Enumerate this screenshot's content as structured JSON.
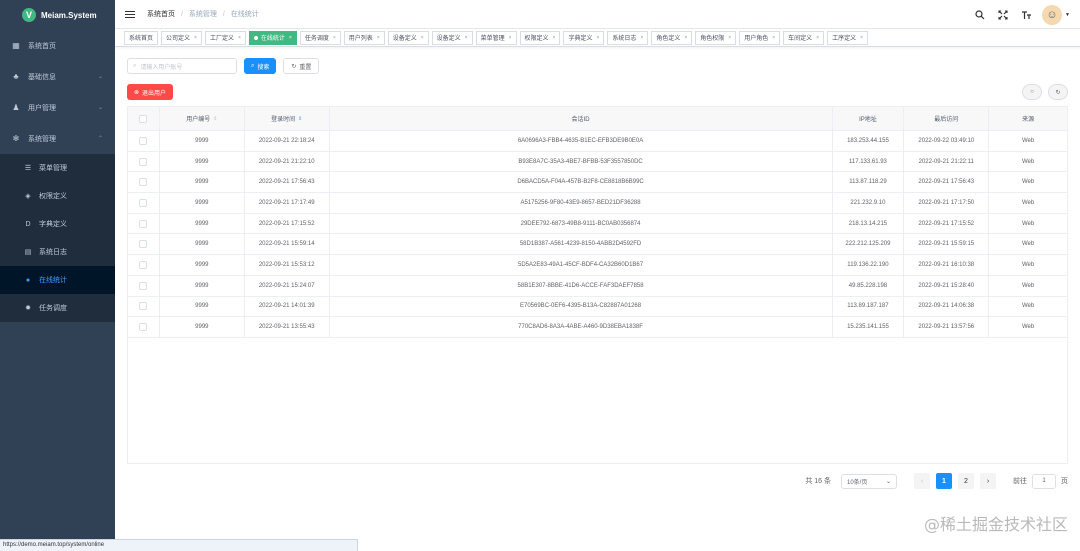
{
  "app": {
    "logo_letter": "V",
    "logo_text": "Meiam.System"
  },
  "sidebar": {
    "items": [
      {
        "label": "系统首页",
        "icon": "dashboard-icon"
      },
      {
        "label": "基础信息",
        "icon": "tree-icon",
        "chevron": "⌄"
      },
      {
        "label": "用户管理",
        "icon": "user-icon",
        "chevron": "⌄"
      },
      {
        "label": "系统管理",
        "icon": "gear-icon",
        "chevron": "⌃"
      }
    ],
    "subitems": [
      {
        "label": "菜单管理",
        "icon": "list-icon"
      },
      {
        "label": "权限定义",
        "icon": "shield-icon"
      },
      {
        "label": "字典定义",
        "icon": "dict-icon"
      },
      {
        "label": "系统日志",
        "icon": "log-icon"
      },
      {
        "label": "在线统计",
        "icon": "globe-icon"
      },
      {
        "label": "任务调度",
        "icon": "task-icon"
      }
    ]
  },
  "navbar": {
    "breadcrumb": [
      "系统首页",
      "系统管理",
      "在线统计"
    ]
  },
  "tags": [
    "系统首页",
    "公司定义",
    "工厂定义",
    "在线统计",
    "任务调度",
    "用户列表",
    "设备定义",
    "设备定义",
    "菜单管理",
    "权限定义",
    "字典定义",
    "系统日志",
    "角色定义",
    "角色权限",
    "用户角色",
    "车间定义",
    "工序定义"
  ],
  "search": {
    "placeholder": "请输入用户账号",
    "search_label": "搜索",
    "reset_label": "重置"
  },
  "actions": {
    "logout_label": "退出用户"
  },
  "table": {
    "headers": [
      "用户编号",
      "登录时间",
      "会话ID",
      "IP地址",
      "最后访问",
      "来源"
    ],
    "rows": [
      [
        "9999",
        "2022-09-21 22:18:24",
        "6A0696A3-FBB4-4635-B1EC-EFB3DE9B0E0A",
        "183.253.44.155",
        "2022-09-22 03:49:10",
        "Web"
      ],
      [
        "9999",
        "2022-09-21 21:22:10",
        "B93E8A7C-35A3-4BE7-BFBB-53F3557850DC",
        "117.133.61.93",
        "2022-09-21 21:22:11",
        "Web"
      ],
      [
        "9999",
        "2022-09-21 17:56:43",
        "D6BACD5A-F04A-457B-B2F8-CE8818B6B99C",
        "113.87.118.29",
        "2022-09-21 17:56:43",
        "Web"
      ],
      [
        "9999",
        "2022-09-21 17:17:49",
        "A5175256-9F80-43E9-8657-BED21DF36288",
        "221.232.9.10",
        "2022-09-21 17:17:50",
        "Web"
      ],
      [
        "9999",
        "2022-09-21 17:15:52",
        "29DEE792-6873-49B8-9111-BC0AB0356874",
        "218.13.14.215",
        "2022-09-21 17:15:52",
        "Web"
      ],
      [
        "9999",
        "2022-09-21 15:59:14",
        "58D1B387-A561-4239-8150-4ABB2D4592FD",
        "222.212.125.209",
        "2022-09-21 15:59:15",
        "Web"
      ],
      [
        "9999",
        "2022-09-21 15:53:12",
        "5D5A2E83-49A1-45CF-BDF4-CA32B60D1B67",
        "119.136.22.190",
        "2022-09-21 16:10:38",
        "Web"
      ],
      [
        "9999",
        "2022-09-21 15:24:07",
        "58B1E307-8BBE-41D6-ACCE-FAF3DAEF7858",
        "49.85.228.198",
        "2022-09-21 15:28:40",
        "Web"
      ],
      [
        "9999",
        "2022-09-21 14:01:39",
        "E70569BC-0EF6-4395-B13A-C82887A01268",
        "113.89.187.187",
        "2022-09-21 14:06:38",
        "Web"
      ],
      [
        "9999",
        "2022-09-21 13:55:43",
        "770C8AD6-8A3A-4ABE-A460-9D38EBA1838F",
        "15.235.141.155",
        "2022-09-21 13:57:56",
        "Web"
      ]
    ]
  },
  "pagination": {
    "total": "共 16 条",
    "page_size": "10条/页",
    "pages": [
      "1",
      "2"
    ],
    "goto_label": "前往",
    "goto_value": "1",
    "page_suffix": "页"
  },
  "status_url": "https://demo.meiam.top/system/online",
  "watermark": "@稀土掘金技术社区"
}
